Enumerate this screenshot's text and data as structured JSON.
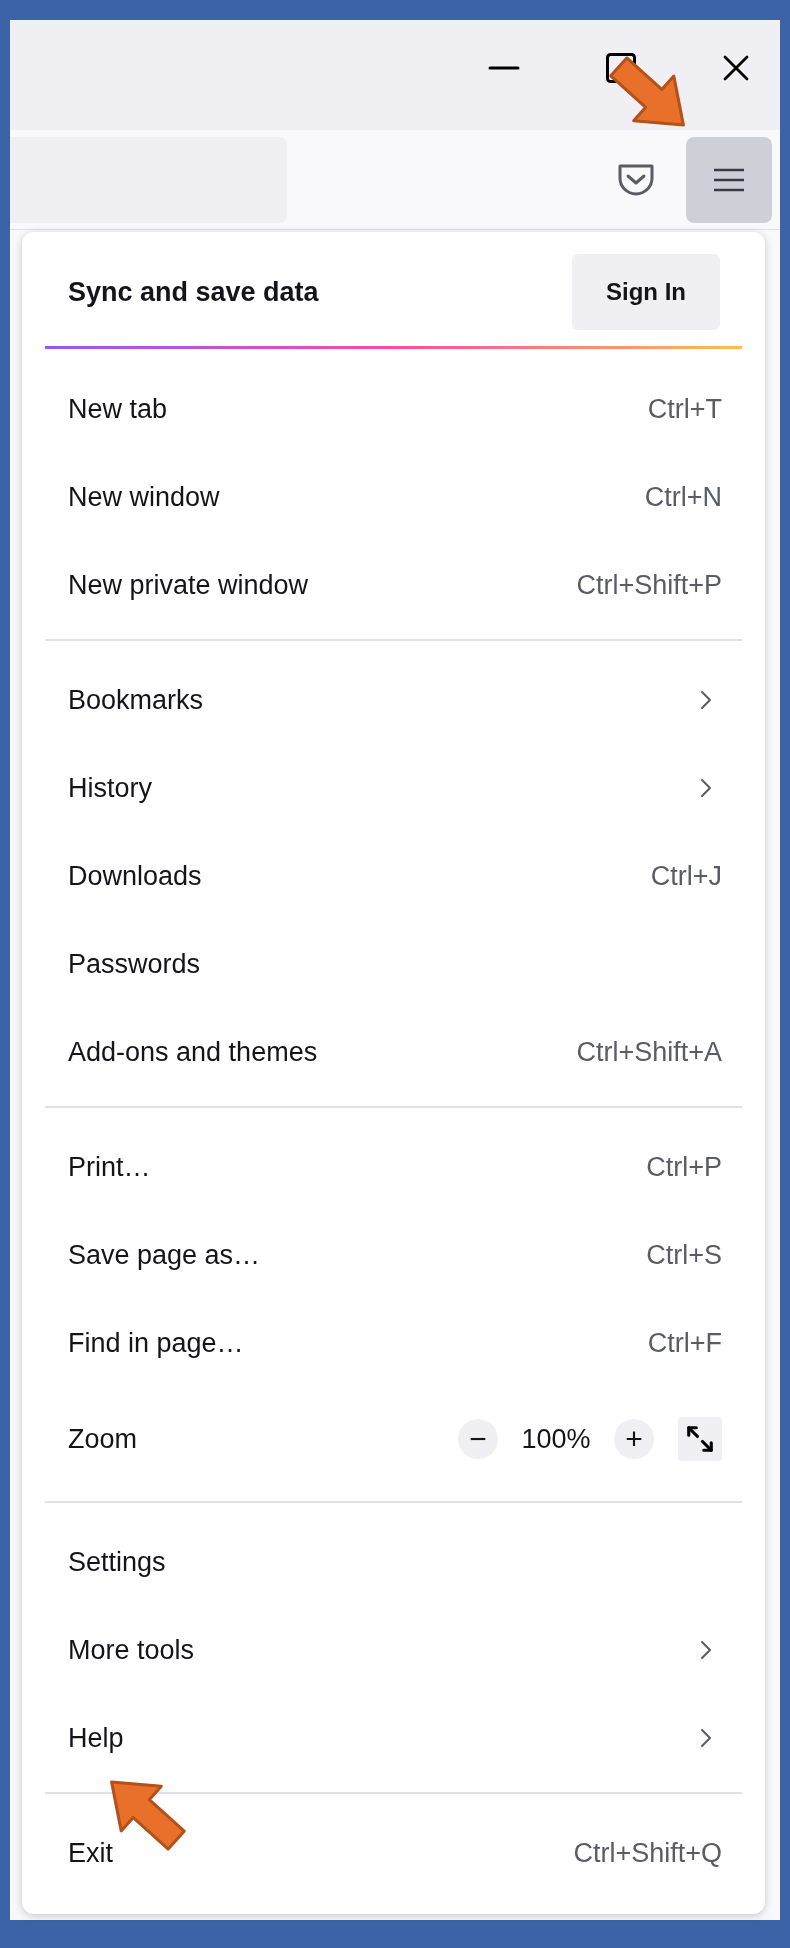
{
  "toolbar": {
    "menu_button": {
      "pressed": true
    }
  },
  "menu": {
    "header": {
      "title": "Sync and save data",
      "button": "Sign In"
    },
    "sections": [
      [
        {
          "kind": "shortcut",
          "label": "New tab",
          "shortcut": "Ctrl+T"
        },
        {
          "kind": "shortcut",
          "label": "New window",
          "shortcut": "Ctrl+N"
        },
        {
          "kind": "shortcut",
          "label": "New private window",
          "shortcut": "Ctrl+Shift+P"
        }
      ],
      [
        {
          "kind": "submenu",
          "label": "Bookmarks"
        },
        {
          "kind": "submenu",
          "label": "History"
        },
        {
          "kind": "shortcut",
          "label": "Downloads",
          "shortcut": "Ctrl+J"
        },
        {
          "kind": "plain",
          "label": "Passwords"
        },
        {
          "kind": "shortcut",
          "label": "Add-ons and themes",
          "shortcut": "Ctrl+Shift+A"
        }
      ],
      [
        {
          "kind": "shortcut",
          "label": "Print…",
          "shortcut": "Ctrl+P"
        },
        {
          "kind": "shortcut",
          "label": "Save page as…",
          "shortcut": "Ctrl+S"
        },
        {
          "kind": "shortcut",
          "label": "Find in page…",
          "shortcut": "Ctrl+F"
        },
        {
          "kind": "zoom",
          "label": "Zoom",
          "minus": "−",
          "value": "100%",
          "plus": "+"
        }
      ],
      [
        {
          "kind": "plain",
          "label": "Settings"
        },
        {
          "kind": "submenu",
          "label": "More tools"
        },
        {
          "kind": "submenu",
          "label": "Help"
        }
      ],
      [
        {
          "kind": "shortcut",
          "label": "Exit",
          "shortcut": "Ctrl+Shift+Q"
        }
      ]
    ]
  }
}
